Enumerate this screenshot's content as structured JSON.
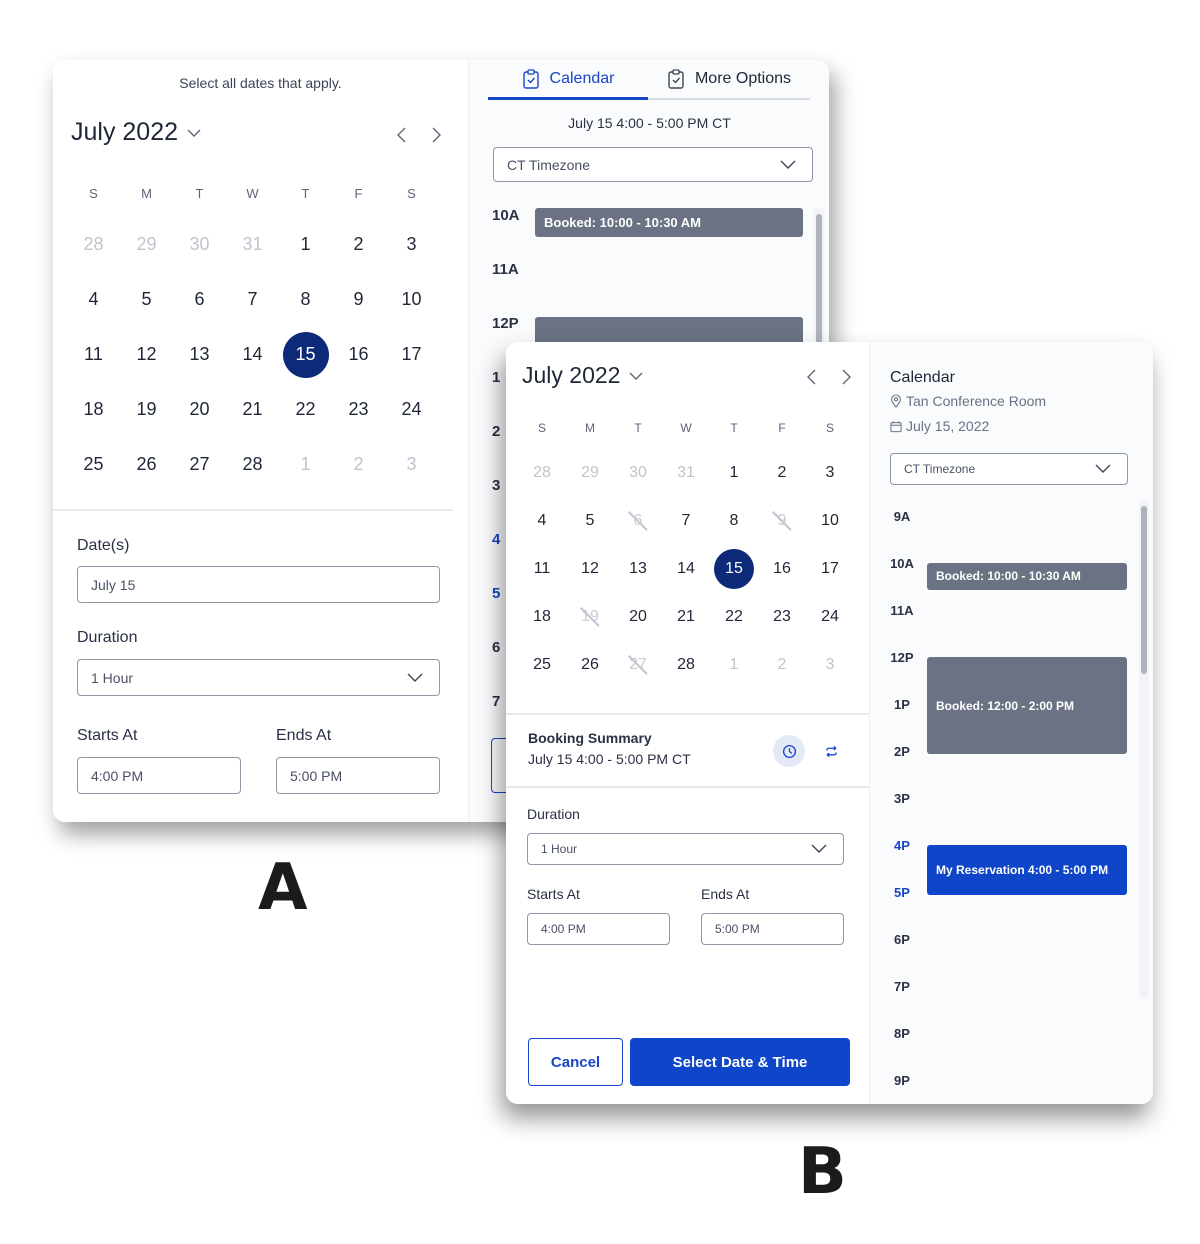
{
  "panel_a": {
    "hint": "Select all dates that apply.",
    "month_label": "July 2022",
    "weekdays": [
      "S",
      "M",
      "T",
      "W",
      "T",
      "F",
      "S"
    ],
    "weeks": [
      [
        {
          "d": "28",
          "s": "muted"
        },
        {
          "d": "29",
          "s": "muted"
        },
        {
          "d": "30",
          "s": "muted"
        },
        {
          "d": "31",
          "s": "muted"
        },
        {
          "d": "1",
          "s": "normal"
        },
        {
          "d": "2",
          "s": "normal"
        },
        {
          "d": "3",
          "s": "normal"
        }
      ],
      [
        {
          "d": "4",
          "s": "normal"
        },
        {
          "d": "5",
          "s": "normal"
        },
        {
          "d": "6",
          "s": "normal"
        },
        {
          "d": "7",
          "s": "normal"
        },
        {
          "d": "8",
          "s": "normal"
        },
        {
          "d": "9",
          "s": "normal"
        },
        {
          "d": "10",
          "s": "normal"
        }
      ],
      [
        {
          "d": "11",
          "s": "normal"
        },
        {
          "d": "12",
          "s": "normal"
        },
        {
          "d": "13",
          "s": "normal"
        },
        {
          "d": "14",
          "s": "normal"
        },
        {
          "d": "15",
          "s": "selected"
        },
        {
          "d": "16",
          "s": "normal"
        },
        {
          "d": "17",
          "s": "normal"
        }
      ],
      [
        {
          "d": "18",
          "s": "normal"
        },
        {
          "d": "19",
          "s": "normal"
        },
        {
          "d": "20",
          "s": "normal"
        },
        {
          "d": "21",
          "s": "normal"
        },
        {
          "d": "22",
          "s": "normal"
        },
        {
          "d": "23",
          "s": "normal"
        },
        {
          "d": "24",
          "s": "normal"
        }
      ],
      [
        {
          "d": "25",
          "s": "normal"
        },
        {
          "d": "26",
          "s": "normal"
        },
        {
          "d": "27",
          "s": "normal"
        },
        {
          "d": "28",
          "s": "normal"
        },
        {
          "d": "1",
          "s": "muted"
        },
        {
          "d": "2",
          "s": "muted"
        },
        {
          "d": "3",
          "s": "muted"
        }
      ]
    ],
    "dates_label": "Date(s)",
    "dates_value": "July 15",
    "duration_label": "Duration",
    "duration_value": "1 Hour",
    "starts_label": "Starts At",
    "starts_value": "4:00 PM",
    "ends_label": "Ends At",
    "ends_value": "5:00 PM",
    "tabs": [
      {
        "label": "Calendar",
        "icon": "clipboard-check-icon",
        "active": true
      },
      {
        "label": "More Options",
        "icon": "clipboard-check-icon",
        "active": false
      }
    ],
    "summary": "July 15 4:00 - 5:00 PM CT",
    "timezone": "CT Timezone",
    "hours": [
      "10A",
      "11A",
      "12P",
      "1",
      "2",
      "3",
      "4",
      "5",
      "6",
      "7"
    ],
    "highlight_hours": [
      "4",
      "5"
    ],
    "events": [
      {
        "label": "Booked: 10:00 - 10:30 AM",
        "type": "booked"
      },
      {
        "label": "",
        "type": "booked"
      }
    ],
    "caption": "A"
  },
  "panel_b": {
    "month_label": "July 2022",
    "weekdays": [
      "S",
      "M",
      "T",
      "W",
      "T",
      "F",
      "S"
    ],
    "weeks": [
      [
        {
          "d": "28",
          "s": "muted"
        },
        {
          "d": "29",
          "s": "muted"
        },
        {
          "d": "30",
          "s": "muted"
        },
        {
          "d": "31",
          "s": "muted"
        },
        {
          "d": "1",
          "s": "normal"
        },
        {
          "d": "2",
          "s": "normal"
        },
        {
          "d": "3",
          "s": "normal"
        }
      ],
      [
        {
          "d": "4",
          "s": "normal"
        },
        {
          "d": "5",
          "s": "normal"
        },
        {
          "d": "6",
          "s": "blocked"
        },
        {
          "d": "7",
          "s": "normal"
        },
        {
          "d": "8",
          "s": "normal"
        },
        {
          "d": "9",
          "s": "blocked"
        },
        {
          "d": "10",
          "s": "normal"
        }
      ],
      [
        {
          "d": "11",
          "s": "normal"
        },
        {
          "d": "12",
          "s": "normal"
        },
        {
          "d": "13",
          "s": "normal"
        },
        {
          "d": "14",
          "s": "normal"
        },
        {
          "d": "15",
          "s": "selected"
        },
        {
          "d": "16",
          "s": "normal"
        },
        {
          "d": "17",
          "s": "normal"
        }
      ],
      [
        {
          "d": "18",
          "s": "normal"
        },
        {
          "d": "19",
          "s": "blocked"
        },
        {
          "d": "20",
          "s": "normal"
        },
        {
          "d": "21",
          "s": "normal"
        },
        {
          "d": "22",
          "s": "normal"
        },
        {
          "d": "23",
          "s": "normal"
        },
        {
          "d": "24",
          "s": "normal"
        }
      ],
      [
        {
          "d": "25",
          "s": "normal"
        },
        {
          "d": "26",
          "s": "normal"
        },
        {
          "d": "27",
          "s": "blocked"
        },
        {
          "d": "28",
          "s": "normal"
        },
        {
          "d": "1",
          "s": "muted"
        },
        {
          "d": "2",
          "s": "muted"
        },
        {
          "d": "3",
          "s": "muted"
        }
      ]
    ],
    "booking_summary_title": "Booking Summary",
    "booking_summary_value": "July 15 4:00 - 5:00 PM CT",
    "duration_label": "Duration",
    "duration_value": "1 Hour",
    "starts_label": "Starts At",
    "starts_value": "4:00 PM",
    "ends_label": "Ends At",
    "ends_value": "5:00 PM",
    "cancel_label": "Cancel",
    "submit_label": "Select Date & Time",
    "calendar_title": "Calendar",
    "location": "Tan Conference Room",
    "date": "July 15, 2022",
    "timezone": "CT Timezone",
    "hours": [
      "9A",
      "10A",
      "11A",
      "12P",
      "1P",
      "2P",
      "3P",
      "4P",
      "5P",
      "6P",
      "7P",
      "8P",
      "9P"
    ],
    "highlight_hours": [
      "4P",
      "5P"
    ],
    "events": [
      {
        "label": "Booked: 10:00 - 10:30 AM",
        "type": "booked",
        "start": 10,
        "end": 10.5
      },
      {
        "label": "Booked: 12:00 - 2:00 PM",
        "type": "booked",
        "start": 12,
        "end": 14
      },
      {
        "label": "My Reservation 4:00 - 5:00 PM",
        "type": "mine",
        "start": 16,
        "end": 17
      }
    ],
    "caption": "B"
  },
  "colors": {
    "accent": "#1746c8",
    "selected_day": "#0d2a78",
    "booked": "#6a7283",
    "reservation": "#0e45c9"
  }
}
